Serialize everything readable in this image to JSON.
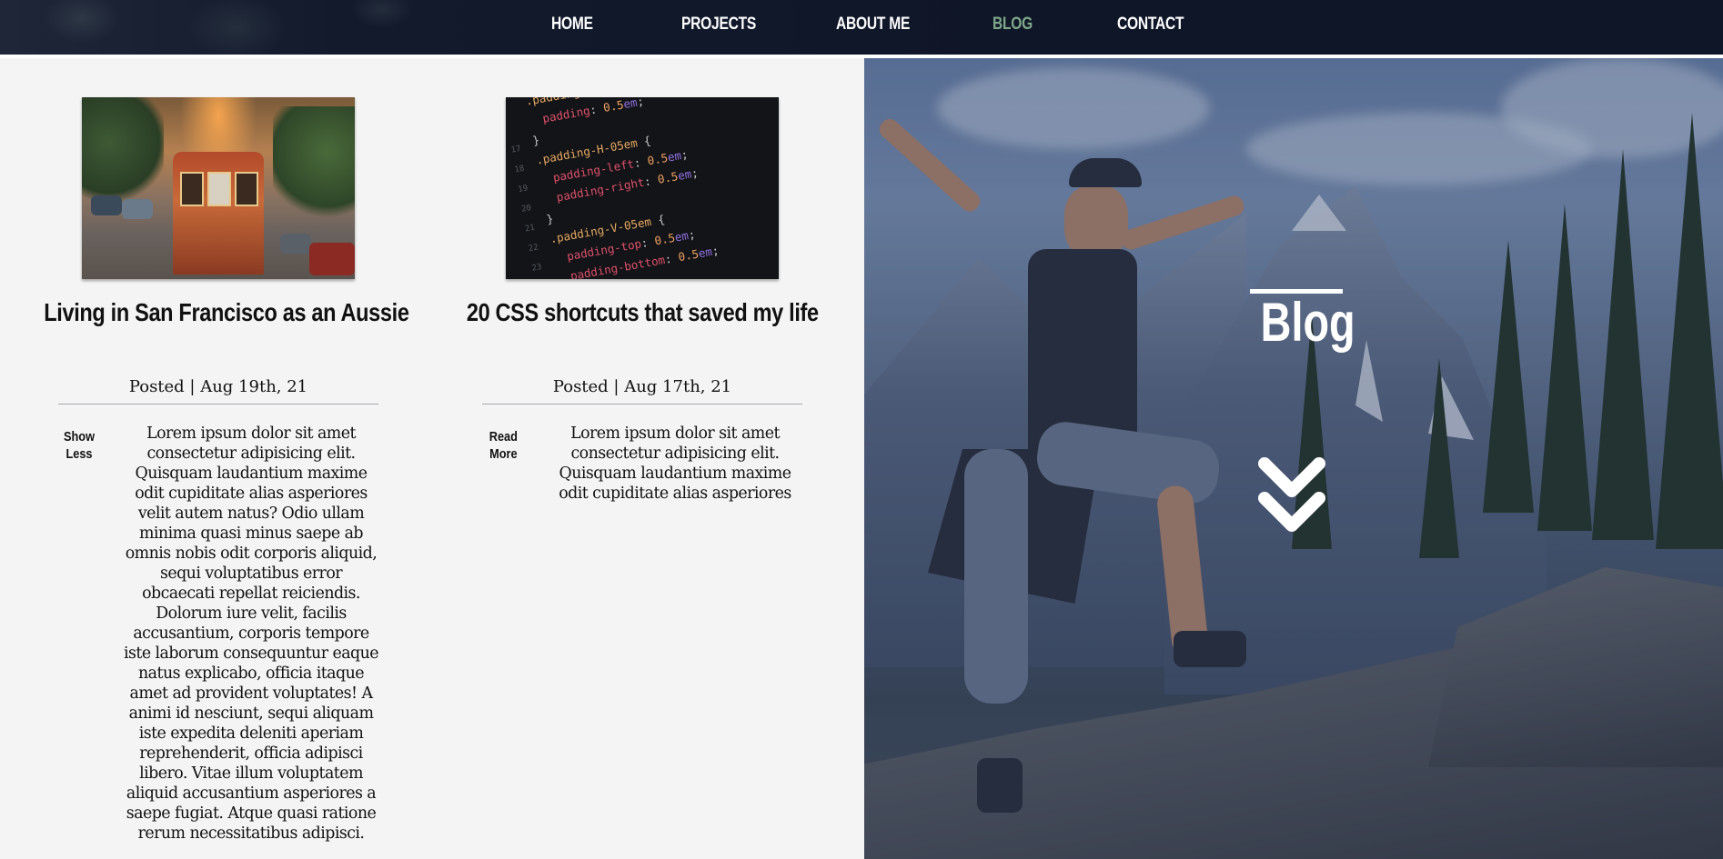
{
  "nav": {
    "items": [
      {
        "label": "HOME"
      },
      {
        "label": "PROJECTS"
      },
      {
        "label": "ABOUT ME"
      },
      {
        "label": "BLOG",
        "active": true
      },
      {
        "label": "CONTACT"
      }
    ],
    "active_color": "#7fa88a"
  },
  "posts": [
    {
      "image_icon": "cable-car-photo",
      "title": "Living in San Francisco as an Aussie",
      "date": "Posted | Aug 19th, 21",
      "toggle": "Show\nLess",
      "body": "Lorem ipsum dolor sit amet consectetur adipisicing elit. Quisquam laudantium maxime odit cupiditate alias asperiores velit autem natus? Odio ullam minima quasi minus saepe ab omnis nobis odit corporis aliquid, sequi voluptatibus error obcaecati repellat reiciendis. Dolorum iure velit, facilis accusantium, corporis tempore iste laborum consequuntur eaque natus explicabo, officia itaque amet ad provident voluptates! A animi id nesciunt, sequi aliquam iste expedita deleniti aperiam reprehenderit, officia adipisci libero. Vitae illum voluptatem aliquid accusantium asperiores a saepe fugiat. Atque quasi ratione rerum necessitatibus adipisci."
    },
    {
      "image_icon": "css-code-photo",
      "title": "20 CSS shortcuts that saved my life",
      "date": "Posted | Aug 17th, 21",
      "toggle": "Read\nMore",
      "body": "Lorem ipsum dolor sit amet consectetur adipisicing elit. Quisquam laudantium maxime odit cupiditate alias asperiores"
    }
  ],
  "hero": {
    "title": "Blog",
    "scroll_icon": "double-chevron-down-icon"
  }
}
